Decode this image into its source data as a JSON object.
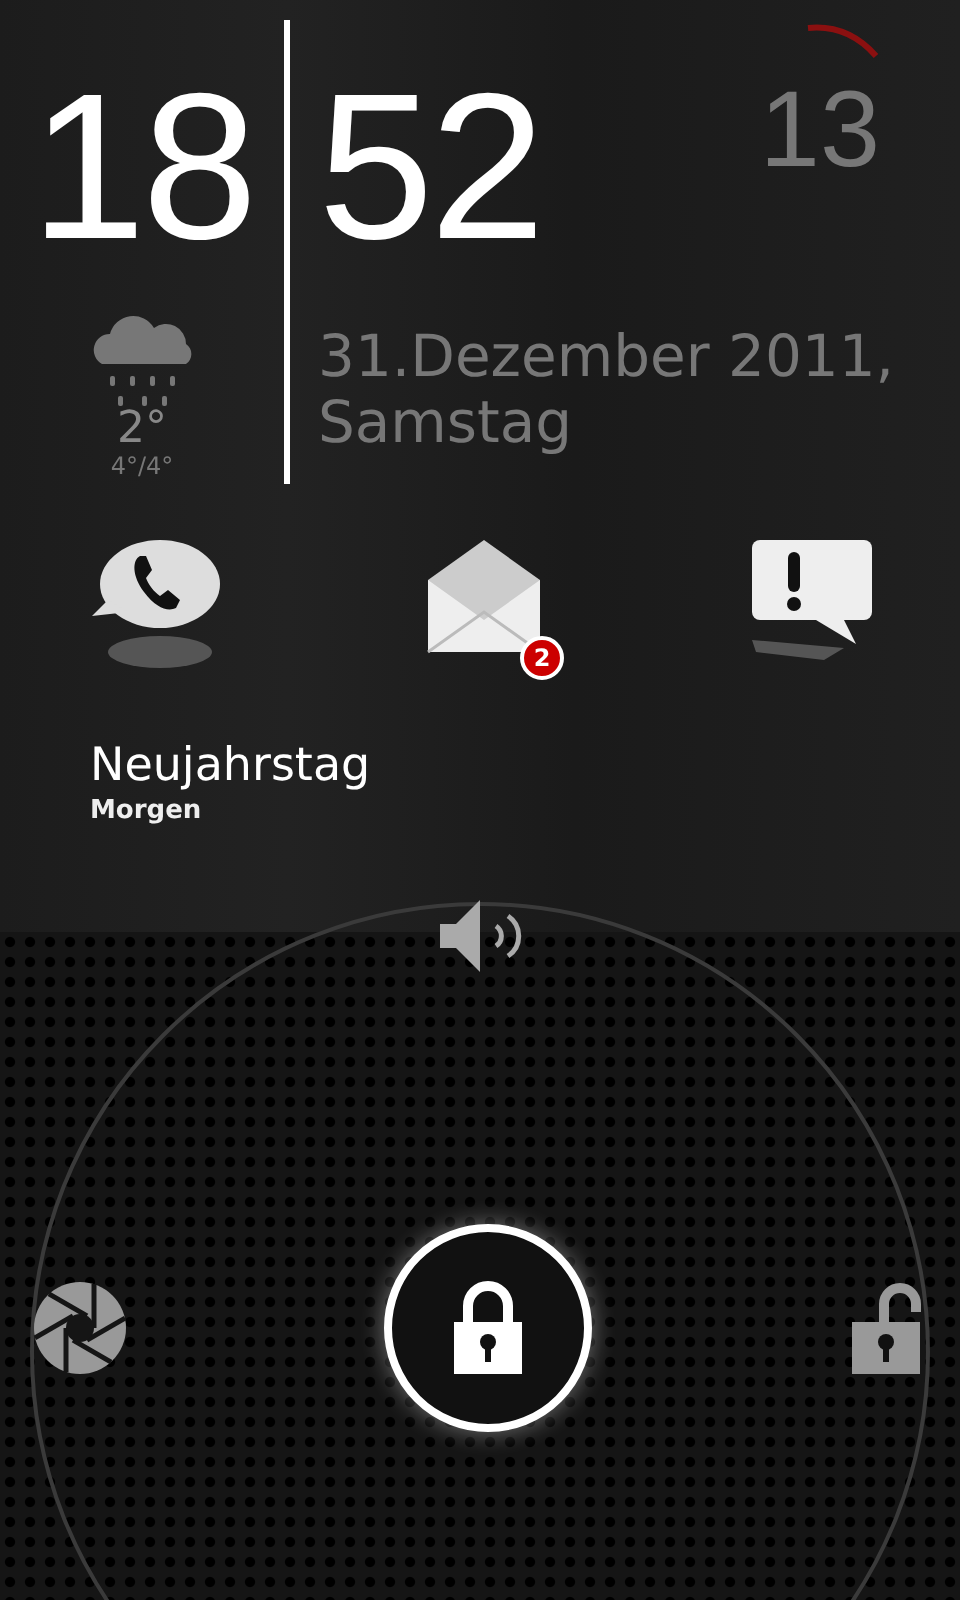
{
  "clock": {
    "hour": "18",
    "minute": "52",
    "seconds": "13"
  },
  "date": {
    "line_1": "31.Dezember 2011,",
    "line_2": "Samstag"
  },
  "weather": {
    "temperature": "2°",
    "range": "4°/4°"
  },
  "notifications": [
    {
      "kind": "phone"
    },
    {
      "kind": "mail",
      "badge": "2"
    },
    {
      "kind": "alert"
    }
  ],
  "event": {
    "title": "Neujahrstag",
    "when": "Morgen"
  },
  "unlock_controls": [
    {
      "kind": "camera"
    },
    {
      "kind": "lock"
    },
    {
      "kind": "unlock"
    }
  ]
}
